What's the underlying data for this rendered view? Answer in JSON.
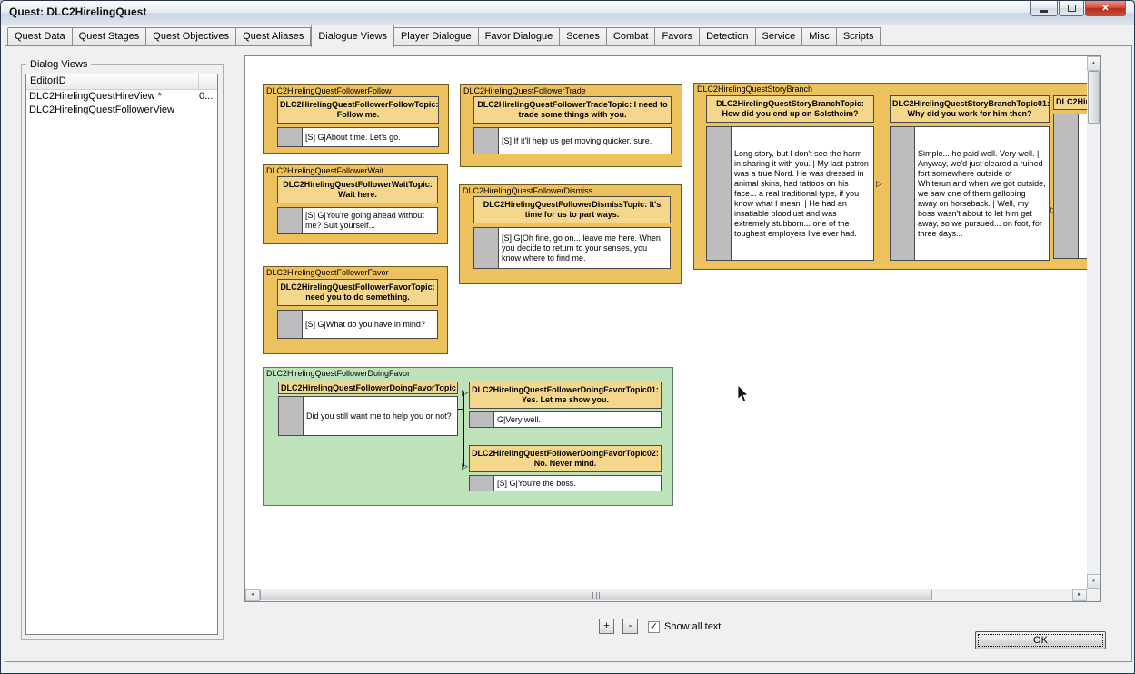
{
  "window": {
    "title": "Quest: DLC2HirelingQuest"
  },
  "window_controls": {
    "close_glyph": "✕"
  },
  "tabs": [
    {
      "label": "Quest Data"
    },
    {
      "label": "Quest Stages"
    },
    {
      "label": "Quest Objectives"
    },
    {
      "label": "Quest Aliases"
    },
    {
      "label": "Dialogue Views"
    },
    {
      "label": "Player Dialogue"
    },
    {
      "label": "Favor Dialogue"
    },
    {
      "label": "Scenes"
    },
    {
      "label": "Combat"
    },
    {
      "label": "Favors"
    },
    {
      "label": "Detection"
    },
    {
      "label": "Service"
    },
    {
      "label": "Misc"
    },
    {
      "label": "Scripts"
    }
  ],
  "sidebar": {
    "group_title": "Dialog Views",
    "column_header": "EditorID",
    "rows": [
      {
        "editor_id": "DLC2HirelingQuestHireView *",
        "value": "0..."
      },
      {
        "editor_id": "DLC2HirelingQuestFollowerView",
        "value": ""
      }
    ]
  },
  "nodes": {
    "follower_follow": {
      "name": "DLC2HirelingQuestFollowerFollow",
      "topic": "DLC2HirelingQuestFollowerFollowTopic: Follow me.",
      "response": "[S] G|About time. Let's go."
    },
    "follower_trade": {
      "name": "DLC2HirelingQuestFollowerTrade",
      "topic": "DLC2HirelingQuestFollowerTradeTopic: I need to trade some things with you.",
      "response": "[S] If it'll help us get moving quicker, sure."
    },
    "story_branch": {
      "name": "DLC2HirelingQuestStoryBranch",
      "topics": [
        {
          "title": "DLC2HirelingQuestStoryBranchTopic: How did you end up on Solstheim?",
          "response": "Long story, but I don't see the harm in sharing it with you. | My last patron was a true Nord. He was dressed in animal skins, had tattoos on his face... a real traditional type, if you know what I mean. | He had an insatiable bloodlust and was extremely stubborn... one of the toughest employers I've ever had."
        },
        {
          "title": "DLC2HirelingQuestStoryBranchTopic01: Why did you work for him then?",
          "response": "Simple... he paid well. Very well. | Anyway, we'd just cleared a ruined fort somewhere outside of Whiterun and when we got outside, we saw one of them galloping away on horseback. | Well, my boss wasn't about to let him get away, so we pursued... on foot, for three days..."
        }
      ],
      "clipped_label": "DLC2Hir"
    },
    "follower_wait": {
      "name": "DLC2HirelingQuestFollowerWait",
      "topic": "DLC2HirelingQuestFollowerWaitTopic: Wait here.",
      "response": "[S] G|You're going ahead without me? Suit yourself..."
    },
    "follower_dismiss": {
      "name": "DLC2HirelingQuestFollowerDismiss",
      "topic": "DLC2HirelingQuestFollowerDismissTopic: It's time for us to part ways.",
      "response": "[S] G|Oh fine, go on... leave me here. When you decide to return to your senses, you know where to find me."
    },
    "follower_favor": {
      "name": "DLC2HirelingQuestFollowerFavor",
      "topic": "DLC2HirelingQuestFollowerFavorTopic: need you to do something.",
      "response": "[S] G|What do you have in mind?"
    },
    "doing_favor": {
      "name": "DLC2HirelingQuestFollowerDoingFavor",
      "main_topic": "DLC2HirelingQuestFollowerDoingFavorTopic",
      "main_response": "Did you still want me to help you or not?",
      "option1_topic": "DLC2HirelingQuestFollowerDoingFavorTopic01: Yes. Let me show you.",
      "option1_response": "G|Very well.",
      "option2_topic": "DLC2HirelingQuestFollowerDoingFavorTopic02: No. Never mind.",
      "option2_response": "[S] G|You're the boss."
    }
  },
  "icons": {
    "scroll_up": "▲",
    "scroll_down": "▼",
    "scroll_left": "◄",
    "scroll_right": "►",
    "connector": "▷",
    "check": "✓"
  },
  "footer": {
    "zoom_in": "+",
    "zoom_out": "-",
    "show_all_text": "Show all text",
    "ok": "OK"
  },
  "colors": {
    "node_fill": "#edc25e",
    "topic_header_fill": "#f4d78c",
    "favor_group_fill": "#bee3bb",
    "response_fill": "#ffffff",
    "flag_fill": "#bdbdbd",
    "close_button": "#c13a28"
  }
}
